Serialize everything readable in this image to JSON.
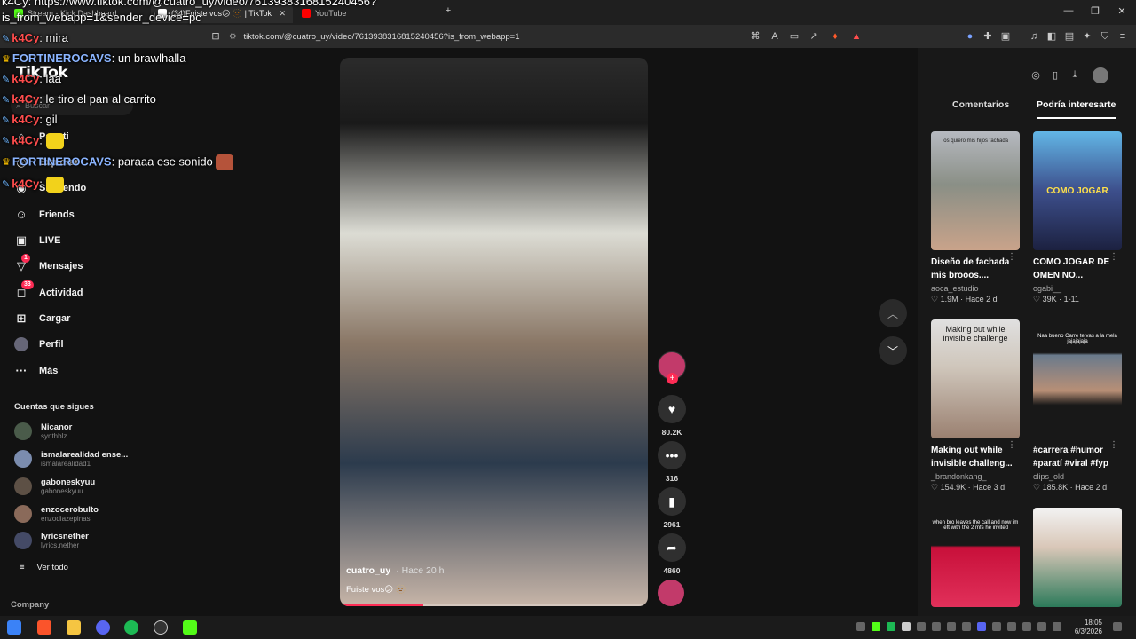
{
  "browser": {
    "tabs": [
      {
        "label": "Stream - Kick Dashboard",
        "color": "#53fc18"
      },
      {
        "label": "(34)Fuiste vos😕 🫥 | TikTok",
        "color": "#ffffff"
      },
      {
        "label": "YouTube",
        "color": "#ff0000"
      }
    ],
    "new_tab_icon": "plus-icon",
    "url": "tiktok.com/@cuatro_uy/video/7613938316815240456?is_from_webapp=1",
    "window_controls": [
      "—",
      "❐",
      "✕"
    ]
  },
  "chat": {
    "overlay_line": "is_from_webapp=1&sender_device=pc",
    "top_line": "k4Cy: https://www.tiktok.com/@cuatro_uy/video/7613938316815240456?",
    "messages": [
      {
        "user": "k4Cy",
        "text": ": mira",
        "user_color": "#ff4d4d"
      },
      {
        "user": "FORTINEROCAVS",
        "text": ": un brawlhalla",
        "user_color": "#8ab4ff"
      },
      {
        "user": "k4Cy",
        "text": ": laa",
        "user_color": "#ff4d4d"
      },
      {
        "user": "k4Cy",
        "text": ": le tiro el pan al carrito",
        "user_color": "#ff4d4d"
      },
      {
        "user": "k4Cy",
        "text": ": gil",
        "user_color": "#ff4d4d"
      },
      {
        "user": "k4Cy",
        "text": ":",
        "user_color": "#ff4d4d"
      },
      {
        "user": "FORTINEROCAVS",
        "text": ": paraaa ese sonido",
        "user_color": "#8ab4ff"
      },
      {
        "user": "k4Cy",
        "text": ":",
        "user_color": "#ff4d4d"
      }
    ]
  },
  "sidebar": {
    "logo": "TikTok",
    "search_placeholder": "Buscar",
    "nav": [
      {
        "label": "Para ti",
        "icon": "home-icon",
        "badge": ""
      },
      {
        "label": "Explorar",
        "icon": "compass-icon",
        "badge": ""
      },
      {
        "label": "Siguiendo",
        "icon": "following-icon",
        "badge": ""
      },
      {
        "label": "Friends",
        "icon": "friends-icon",
        "badge": ""
      },
      {
        "label": "LIVE",
        "icon": "live-icon",
        "badge": ""
      },
      {
        "label": "Mensajes",
        "icon": "messages-icon",
        "badge": "1"
      },
      {
        "label": "Actividad",
        "icon": "activity-icon",
        "badge": "33"
      },
      {
        "label": "Cargar",
        "icon": "upload-icon",
        "badge": ""
      },
      {
        "label": "Perfil",
        "icon": "profile-icon",
        "badge": ""
      },
      {
        "label": "Más",
        "icon": "more-icon",
        "badge": ""
      }
    ],
    "following_title": "Cuentas que sigues",
    "following": [
      {
        "name": "Nicanor",
        "handle": "synthblz"
      },
      {
        "name": "ismalarealidad ense...",
        "handle": "ismalarealidad1"
      },
      {
        "name": "gaboneskyuu",
        "handle": "gaboneskyuu"
      },
      {
        "name": "enzocerobulto",
        "handle": "enzodiazepinas"
      },
      {
        "name": "lyricsnether",
        "handle": "lyrics.nether"
      }
    ],
    "see_all": "Ver todo",
    "company": "Company"
  },
  "video": {
    "author": "cuatro_uy",
    "time": "· Hace 20 h",
    "caption": "Fuiste vos😕 🫥",
    "progress": 0.27
  },
  "actions": {
    "likes": "80.2K",
    "comments": "316",
    "saves": "2961",
    "shares": "4860"
  },
  "right_panel": {
    "tabs": [
      "Comentarios",
      "Podría interesarte"
    ],
    "cards": [
      {
        "title": "Diseño de fachada mis brooos....",
        "author": "aoca_estudio",
        "likes": "1.9M",
        "date": "Hace 2 d",
        "thumb_text": "los quiero mis hijos fachada",
        "thumb_color": "#8a8f86"
      },
      {
        "title": "COMO JOGAR DE OMEN NO...",
        "author": "ogabi__",
        "likes": "39K",
        "date": "1-11",
        "thumb_text": "COMO JOGAR",
        "thumb_color": "#3d4f8c"
      },
      {
        "title": "Making out while invisible challeng...",
        "author": "_brandonkang_",
        "likes": "154.9K",
        "date": "Hace 3 d",
        "thumb_text": "Making out while invisible challenge",
        "thumb_color": "#d9d9d9"
      },
      {
        "title": "#carrera #humor #paratí #viral #fyp",
        "author": "clips_old",
        "likes": "185.8K",
        "date": "Hace 2 d",
        "thumb_text": "Naa bueno Carre te vas a la mela jajajajaja",
        "thumb_color": "#2a2a2a"
      },
      {
        "title": "",
        "author": "",
        "likes": "",
        "date": "",
        "thumb_text": "when bro leaves the call and now im left with the 2 mfs he invited",
        "thumb_color": "#c8103a"
      },
      {
        "title": "",
        "author": "",
        "likes": "",
        "date": "",
        "thumb_text": "",
        "thumb_color": "#e8e8e8"
      }
    ]
  },
  "taskbar": {
    "time": "18:05",
    "date": "6/3/2026"
  },
  "colors": {
    "accent": "#fe2c55",
    "background": "#121212"
  }
}
